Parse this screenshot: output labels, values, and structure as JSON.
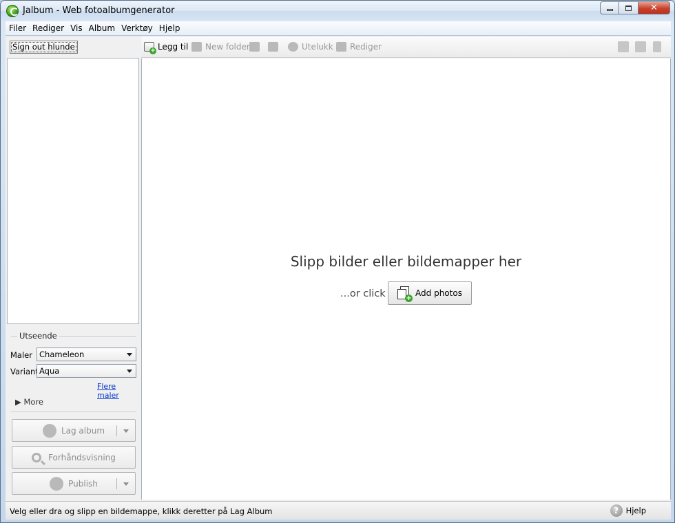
{
  "window": {
    "title": "Jalbum - Web fotoalbumgenerator",
    "controls": {
      "minimize": "",
      "maximize": "",
      "close": "✕"
    }
  },
  "menu": [
    "Filer",
    "Rediger",
    "Vis",
    "Album",
    "Verktøy",
    "Hjelp"
  ],
  "sidebar": {
    "signout_label": "Sign out hlunde",
    "appearance": {
      "heading": "Utseende",
      "template_label": "Maler",
      "template_value": "Chameleon",
      "variant_label": "Variant",
      "variant_value": "Aqua",
      "more_templates_link": "Flere maler",
      "more_label": "▶ More"
    },
    "actions": {
      "make_album": "Lag album",
      "preview": "Forhåndsvisning",
      "publish": "Publish"
    }
  },
  "toolbar": {
    "add": "Legg til",
    "new_folder": "New folder",
    "exclude": "Utelukk",
    "edit": "Rediger"
  },
  "dropzone": {
    "title": "Slipp bilder eller bildemapper her",
    "or_click": "...or click",
    "add_photos": "Add photos"
  },
  "status": {
    "text": "Velg eller dra og slipp en bildemappe, klikk deretter på Lag Album",
    "help": "Hjelp"
  },
  "icons": {
    "app": "jalbum-logo-icon",
    "add": "add-photo-icon",
    "new_folder": "folder-icon",
    "back": "arrow-left-icon",
    "forward": "arrow-right-icon",
    "exclude": "exclude-icon",
    "edit": "edit-icon",
    "view_thumbs": "thumbnails-view-icon",
    "view_list": "list-view-icon",
    "view_details": "details-view-icon",
    "help": "help-icon"
  }
}
